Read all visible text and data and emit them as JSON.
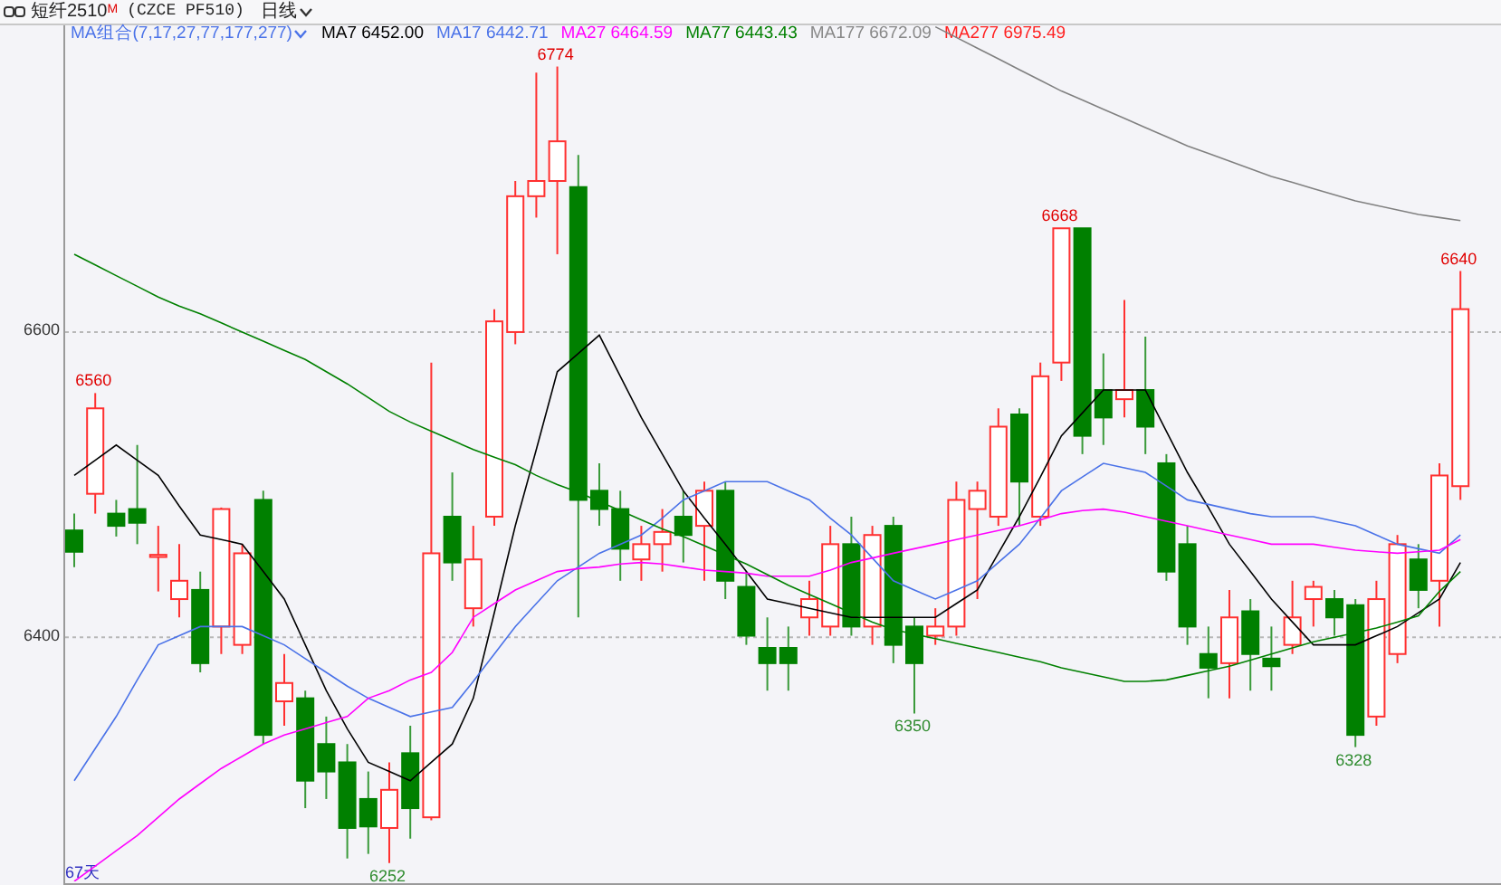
{
  "header": {
    "symbol": "短纤2510",
    "badge": "M",
    "code": "(CZCE PF510)",
    "period": "日线"
  },
  "legend": {
    "group": "MA组合(7,17,27,77,177,277)",
    "values": [
      {
        "value": "6452.00",
        "color": "#000000"
      },
      {
        "value": "6442.71",
        "color": "#4a72e8"
      },
      {
        "value": "6464.59",
        "color": "#ff00ff"
      },
      {
        "value": "6443.43",
        "color": "#008000"
      },
      {
        "value": "6672.09",
        "color": "#888888"
      }
    ],
    "extra": [
      {
        "name": "MA277",
        "value": "6975.49",
        "color": "#ff2020"
      }
    ]
  },
  "chart": {
    "chart_data": {
      "type": "candlestick",
      "ylim": [
        6240,
        6801
      ],
      "yticks": [
        6400,
        6600
      ],
      "ohlc": [
        [
          6470,
          6481,
          6446,
          6456
        ],
        [
          6494,
          6560,
          6481,
          6550
        ],
        [
          6481,
          6490,
          6466,
          6473
        ],
        [
          6484,
          6526,
          6461,
          6475
        ],
        [
          6453,
          6473,
          6430,
          6454
        ],
        [
          6425,
          6461,
          6413,
          6437
        ],
        [
          6431,
          6443,
          6377,
          6383
        ],
        [
          6407,
          6485,
          6389,
          6484
        ],
        [
          6395,
          6461,
          6389,
          6455
        ],
        [
          6490,
          6496,
          6330,
          6336
        ],
        [
          6358,
          6389,
          6342,
          6370
        ],
        [
          6360,
          6365,
          6288,
          6306
        ],
        [
          6330,
          6348,
          6294,
          6312
        ],
        [
          6318,
          6330,
          6255,
          6275
        ],
        [
          6294,
          6312,
          6258,
          6276
        ],
        [
          6275,
          6318,
          6252,
          6300
        ],
        [
          6324,
          6342,
          6268,
          6288
        ],
        [
          6282,
          6580,
          6280,
          6455
        ],
        [
          6479,
          6508,
          6437,
          6449
        ],
        [
          6419,
          6473,
          6407,
          6451
        ],
        [
          6479,
          6615,
          6473,
          6607
        ],
        [
          6600,
          6699,
          6592,
          6689
        ],
        [
          6689,
          6770,
          6675,
          6699
        ],
        [
          6699,
          6774,
          6651,
          6725
        ],
        [
          6695,
          6716,
          6413,
          6490
        ],
        [
          6496,
          6514,
          6473,
          6484
        ],
        [
          6484,
          6496,
          6437,
          6458
        ],
        [
          6451,
          6473,
          6437,
          6461
        ],
        [
          6461,
          6484,
          6443,
          6469
        ],
        [
          6479,
          6496,
          6449,
          6467
        ],
        [
          6473,
          6502,
          6437,
          6496
        ],
        [
          6496,
          6502,
          6425,
          6437
        ],
        [
          6433,
          6443,
          6395,
          6401
        ],
        [
          6393,
          6413,
          6365,
          6383
        ],
        [
          6393,
          6407,
          6365,
          6383
        ],
        [
          6413,
          6437,
          6401,
          6425
        ],
        [
          6407,
          6473,
          6401,
          6461
        ],
        [
          6461,
          6479,
          6401,
          6407
        ],
        [
          6407,
          6473,
          6395,
          6467
        ],
        [
          6473,
          6479,
          6383,
          6395
        ],
        [
          6407,
          6413,
          6350,
          6383
        ],
        [
          6401,
          6419,
          6395,
          6407
        ],
        [
          6407,
          6502,
          6401,
          6490
        ],
        [
          6484,
          6502,
          6425,
          6496
        ],
        [
          6479,
          6550,
          6473,
          6538
        ],
        [
          6546,
          6550,
          6473,
          6502
        ],
        [
          6479,
          6580,
          6473,
          6571
        ],
        [
          6580,
          6668,
          6568,
          6668
        ],
        [
          6668,
          6668,
          6520,
          6532
        ],
        [
          6562,
          6586,
          6526,
          6544
        ],
        [
          6556,
          6621,
          6544,
          6562
        ],
        [
          6562,
          6597,
          6520,
          6538
        ],
        [
          6514,
          6520,
          6437,
          6443
        ],
        [
          6461,
          6473,
          6395,
          6407
        ],
        [
          6389,
          6407,
          6360,
          6380
        ],
        [
          6383,
          6431,
          6360,
          6413
        ],
        [
          6417,
          6425,
          6365,
          6389
        ],
        [
          6386,
          6407,
          6365,
          6381
        ],
        [
          6395,
          6437,
          6389,
          6413
        ],
        [
          6425,
          6437,
          6407,
          6433
        ],
        [
          6425,
          6431,
          6401,
          6413
        ],
        [
          6421,
          6425,
          6328,
          6336
        ],
        [
          6348,
          6437,
          6342,
          6425
        ],
        [
          6389,
          6467,
          6383,
          6461
        ],
        [
          6451,
          6461,
          6419,
          6431
        ],
        [
          6437,
          6514,
          6407,
          6506
        ],
        [
          6499,
          6640,
          6490,
          6615
        ]
      ],
      "annotations": [
        "6560",
        "6252",
        "6774",
        "6350",
        "6668",
        "6328",
        "6640"
      ]
    }
  },
  "moving_averages": {
    "chart_data": {
      "type": "line",
      "ylim": [
        6240,
        6801
      ],
      "series": [
        {
          "name": "MA7",
          "color": "#000000",
          "values": [
            6506,
            6516,
            6526,
            6516,
            6506,
            6486,
            6467,
            6464,
            6461,
            6443,
            6425,
            6395,
            6365,
            6340,
            6318,
            6312,
            6306,
            6318,
            6330,
            6360,
            6416,
            6473,
            6523,
            6574,
            6586,
            6598,
            6571,
            6544,
            6520,
            6496,
            6478,
            6461,
            6443,
            6425,
            6422,
            6419,
            6416,
            6413,
            6413,
            6413,
            6413,
            6413,
            6422,
            6431,
            6455,
            6479,
            6505,
            6532,
            6547,
            6562,
            6562,
            6562,
            6535,
            6508,
            6485,
            6461,
            6443,
            6425,
            6410,
            6395,
            6395,
            6395,
            6401,
            6407,
            6416,
            6425,
            6449
          ]
        },
        {
          "name": "MA17",
          "color": "#4a72e8",
          "values": [
            6306,
            6327,
            6348,
            6372,
            6395,
            6401,
            6407,
            6407,
            6407,
            6401,
            6395,
            6386,
            6377,
            6368,
            6360,
            6354,
            6348,
            6351,
            6354,
            6371,
            6389,
            6407,
            6422,
            6437,
            6446,
            6455,
            6461,
            6467,
            6478,
            6490,
            6496,
            6502,
            6502,
            6502,
            6496,
            6490,
            6478,
            6467,
            6452,
            6437,
            6431,
            6425,
            6431,
            6437,
            6449,
            6461,
            6478,
            6496,
            6505,
            6514,
            6511,
            6508,
            6499,
            6490,
            6487,
            6484,
            6481,
            6479,
            6479,
            6479,
            6476,
            6473,
            6467,
            6461,
            6458,
            6455,
            6467
          ]
        },
        {
          "name": "MA27",
          "color": "#ff00ff",
          "values": [
            6240,
            6250,
            6260,
            6270,
            6282,
            6294,
            6304,
            6314,
            6322,
            6330,
            6336,
            6340,
            6344,
            6348,
            6360,
            6365,
            6372,
            6377,
            6390,
            6413,
            6422,
            6431,
            6437,
            6443,
            6445,
            6446,
            6448,
            6449,
            6448,
            6446,
            6444,
            6443,
            6442,
            6440,
            6440,
            6440,
            6444,
            6449,
            6452,
            6455,
            6458,
            6461,
            6464,
            6467,
            6470,
            6473,
            6477,
            6481,
            6483,
            6484,
            6482,
            6479,
            6476,
            6473,
            6470,
            6467,
            6464,
            6461,
            6461,
            6461,
            6459,
            6457,
            6456,
            6455,
            6456,
            6457,
            6464
          ]
        },
        {
          "name": "MA77",
          "color": "#008000",
          "values": [
            6651,
            6644,
            6637,
            6630,
            6623,
            6617,
            6612,
            6606,
            6600,
            6594,
            6588,
            6582,
            6574,
            6566,
            6557,
            6548,
            6541,
            6535,
            6529,
            6523,
            6518,
            6513,
            6506,
            6500,
            6495,
            6489,
            6483,
            6477,
            6471,
            6466,
            6460,
            6454,
            6448,
            6441,
            6434,
            6428,
            6422,
            6416,
            6410,
            6405,
            6402,
            6399,
            6396,
            6393,
            6390,
            6387,
            6384,
            6380,
            6377,
            6374,
            6371,
            6371,
            6372,
            6375,
            6378,
            6381,
            6385,
            6389,
            6393,
            6397,
            6400,
            6403,
            6406,
            6410,
            6414,
            6430,
            6443
          ]
        },
        {
          "name": "MA177",
          "color": "#808080",
          "values": [
            null,
            null,
            null,
            null,
            null,
            null,
            null,
            null,
            null,
            null,
            null,
            null,
            null,
            null,
            null,
            null,
            null,
            null,
            null,
            null,
            null,
            null,
            null,
            null,
            null,
            null,
            null,
            null,
            null,
            null,
            null,
            null,
            null,
            null,
            null,
            null,
            null,
            null,
            null,
            null,
            null,
            6800,
            6793,
            6786,
            6779,
            6772,
            6765,
            6758,
            6752,
            6746,
            6740,
            6734,
            6728,
            6722,
            6717,
            6712,
            6707,
            6702,
            6698,
            6694,
            6690,
            6686,
            6683,
            6680,
            6677,
            6675,
            6673
          ]
        }
      ]
    }
  },
  "days_label": "67天"
}
